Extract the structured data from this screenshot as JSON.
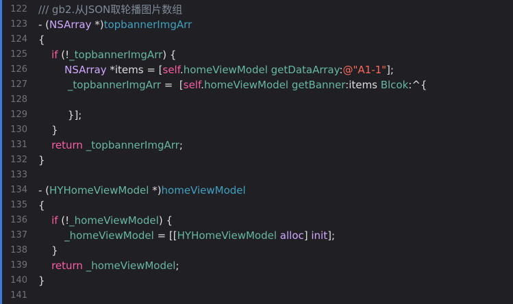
{
  "editor": {
    "accent_color": "#3f7bd9",
    "background": "#1f1f24",
    "lines": [
      {
        "number": "122",
        "tokens": [
          {
            "t": "/// gb2.从JSON取轮播图片数组",
            "c": "comment"
          }
        ]
      },
      {
        "number": "123",
        "tokens": [
          {
            "t": "- (",
            "c": "plain"
          },
          {
            "t": "NSArray",
            "c": "type"
          },
          {
            "t": " *)",
            "c": "plain"
          },
          {
            "t": "topbannerImgArr",
            "c": "method"
          }
        ]
      },
      {
        "number": "124",
        "tokens": [
          {
            "t": "{",
            "c": "plain"
          }
        ]
      },
      {
        "number": "125",
        "tokens": [
          {
            "t": "    ",
            "c": "plain"
          },
          {
            "t": "if",
            "c": "keyword"
          },
          {
            "t": " (!",
            "c": "plain"
          },
          {
            "t": "_topbannerImgArr",
            "c": "project"
          },
          {
            "t": ") {",
            "c": "plain"
          }
        ]
      },
      {
        "number": "126",
        "tokens": [
          {
            "t": "        ",
            "c": "plain"
          },
          {
            "t": "NSArray",
            "c": "type"
          },
          {
            "t": " *items = [",
            "c": "plain"
          },
          {
            "t": "self",
            "c": "keyword"
          },
          {
            "t": ".",
            "c": "plain"
          },
          {
            "t": "homeViewModel",
            "c": "project"
          },
          {
            "t": " ",
            "c": "plain"
          },
          {
            "t": "getDataArray",
            "c": "project"
          },
          {
            "t": ":",
            "c": "plain"
          },
          {
            "t": "@\"A1-1\"",
            "c": "string"
          },
          {
            "t": "];",
            "c": "plain"
          }
        ]
      },
      {
        "number": "127",
        "tokens": [
          {
            "t": "         ",
            "c": "plain"
          },
          {
            "t": "_topbannerImgArr",
            "c": "project"
          },
          {
            "t": " =  [",
            "c": "plain"
          },
          {
            "t": "self",
            "c": "keyword"
          },
          {
            "t": ".",
            "c": "plain"
          },
          {
            "t": "homeViewModel",
            "c": "project"
          },
          {
            "t": " ",
            "c": "plain"
          },
          {
            "t": "getBanner",
            "c": "project"
          },
          {
            "t": ":items ",
            "c": "plain"
          },
          {
            "t": "Blcok",
            "c": "project"
          },
          {
            "t": ":^{",
            "c": "plain"
          }
        ]
      },
      {
        "number": "128",
        "tokens": []
      },
      {
        "number": "129",
        "tokens": [
          {
            "t": "         }];",
            "c": "plain"
          }
        ]
      },
      {
        "number": "130",
        "tokens": [
          {
            "t": "    }",
            "c": "plain"
          }
        ]
      },
      {
        "number": "131",
        "tokens": [
          {
            "t": "    ",
            "c": "plain"
          },
          {
            "t": "return",
            "c": "keyword"
          },
          {
            "t": " ",
            "c": "plain"
          },
          {
            "t": "_topbannerImgArr",
            "c": "project"
          },
          {
            "t": ";",
            "c": "plain"
          }
        ]
      },
      {
        "number": "132",
        "tokens": [
          {
            "t": "}",
            "c": "plain"
          }
        ]
      },
      {
        "number": "133",
        "tokens": []
      },
      {
        "number": "134",
        "tokens": [
          {
            "t": "- (",
            "c": "plain"
          },
          {
            "t": "HYHomeViewModel",
            "c": "project"
          },
          {
            "t": " *)",
            "c": "plain"
          },
          {
            "t": "homeViewModel",
            "c": "method"
          }
        ]
      },
      {
        "number": "135",
        "tokens": [
          {
            "t": "{",
            "c": "plain"
          }
        ]
      },
      {
        "number": "136",
        "tokens": [
          {
            "t": "    ",
            "c": "plain"
          },
          {
            "t": "if",
            "c": "keyword"
          },
          {
            "t": " (!",
            "c": "plain"
          },
          {
            "t": "_homeViewModel",
            "c": "project"
          },
          {
            "t": ") {",
            "c": "plain"
          }
        ]
      },
      {
        "number": "137",
        "tokens": [
          {
            "t": "        ",
            "c": "plain"
          },
          {
            "t": "_homeViewModel",
            "c": "project"
          },
          {
            "t": " = [[",
            "c": "plain"
          },
          {
            "t": "HYHomeViewModel",
            "c": "project"
          },
          {
            "t": " ",
            "c": "plain"
          },
          {
            "t": "alloc",
            "c": "type"
          },
          {
            "t": "] ",
            "c": "plain"
          },
          {
            "t": "init",
            "c": "type"
          },
          {
            "t": "];",
            "c": "plain"
          }
        ]
      },
      {
        "number": "138",
        "tokens": [
          {
            "t": "    }",
            "c": "plain"
          }
        ]
      },
      {
        "number": "139",
        "tokens": [
          {
            "t": "    ",
            "c": "plain"
          },
          {
            "t": "return",
            "c": "keyword"
          },
          {
            "t": " ",
            "c": "plain"
          },
          {
            "t": "_homeViewModel",
            "c": "project"
          },
          {
            "t": ";",
            "c": "plain"
          }
        ]
      },
      {
        "number": "140",
        "tokens": [
          {
            "t": "}",
            "c": "plain"
          }
        ]
      },
      {
        "number": "141",
        "tokens": []
      }
    ]
  }
}
